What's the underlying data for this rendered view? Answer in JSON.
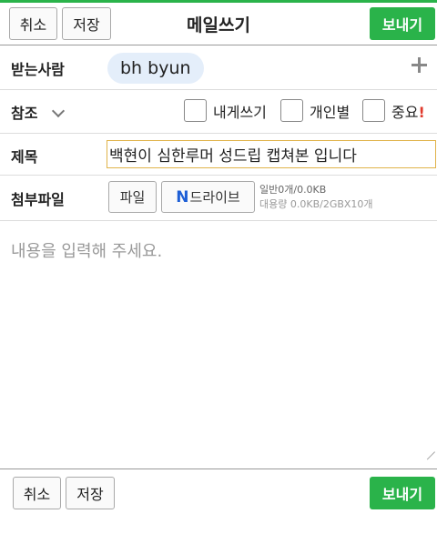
{
  "header": {
    "cancel_label": "취소",
    "save_label": "저장",
    "title": "메일쓰기",
    "send_label": "보내기"
  },
  "recipient": {
    "label": "받는사람",
    "chip": "bh byun",
    "add_icon": "plus-icon"
  },
  "cc": {
    "label": "참조",
    "expand_icon": "chevron-down-icon",
    "options": [
      {
        "label": "내게쓰기",
        "checked": false
      },
      {
        "label": "개인별",
        "checked": false
      },
      {
        "label": "중요",
        "mark": "!",
        "checked": false
      }
    ]
  },
  "subject": {
    "label": "제목",
    "value": "백현이 심한루머 성드립 캡쳐본 입니다"
  },
  "attachment": {
    "label": "첨부파일",
    "file_button": "파일",
    "drive_icon_letter": "N",
    "drive_button": "드라이브",
    "general_usage": "일반0개/0.0KB",
    "large_usage": "대용량 0.0KB/2GBX10개"
  },
  "body": {
    "placeholder": "내용을 입력해 주세요."
  },
  "footer": {
    "cancel_label": "취소",
    "save_label": "저장",
    "send_label": "보내기"
  },
  "colors": {
    "accent_green": "#2ab34a",
    "chip_bg": "#e4eefa",
    "subject_border": "#e0b34a",
    "important_mark": "#e0392b",
    "drive_blue": "#1e5fd6"
  }
}
